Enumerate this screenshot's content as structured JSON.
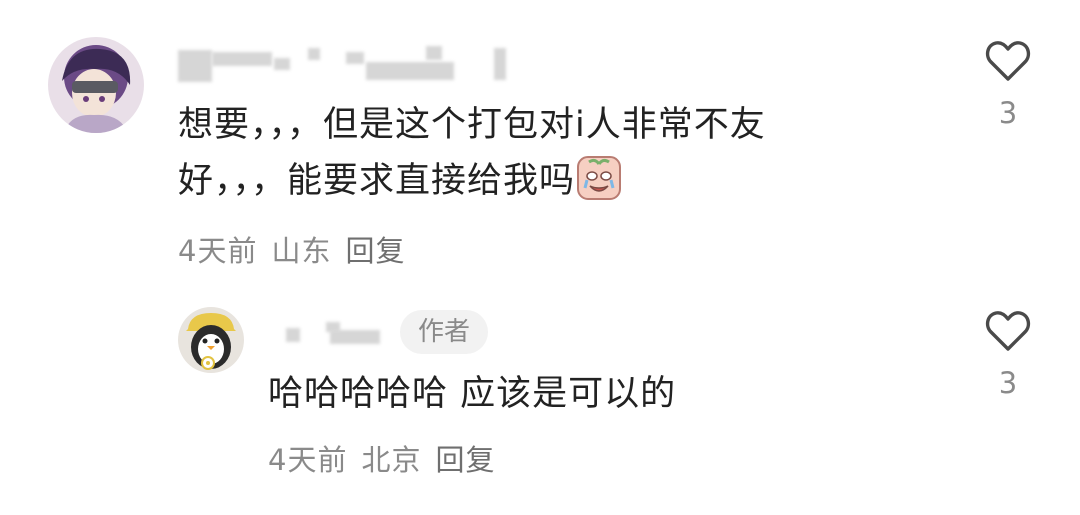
{
  "comments": [
    {
      "username": "",
      "content_line1": "想要，，，但是这个打包对i人非常不友",
      "content_line2": "好，，，能要求直接给我吗",
      "emoji": "crying-face-sticker",
      "time": "4天前",
      "location": "山东",
      "reply_label": "回复",
      "likes": "3"
    },
    {
      "username": "",
      "author_badge": "作者",
      "content": "哈哈哈哈哈 应该是可以的",
      "time": "4天前",
      "location": "北京",
      "reply_label": "回复",
      "likes": "3"
    }
  ],
  "icons": {
    "like": "heart-outline-icon"
  },
  "colors": {
    "text": "#222222",
    "meta": "#8a8a8a",
    "badge_bg": "#f2f2f2",
    "redacted": "#d6d6d6"
  }
}
